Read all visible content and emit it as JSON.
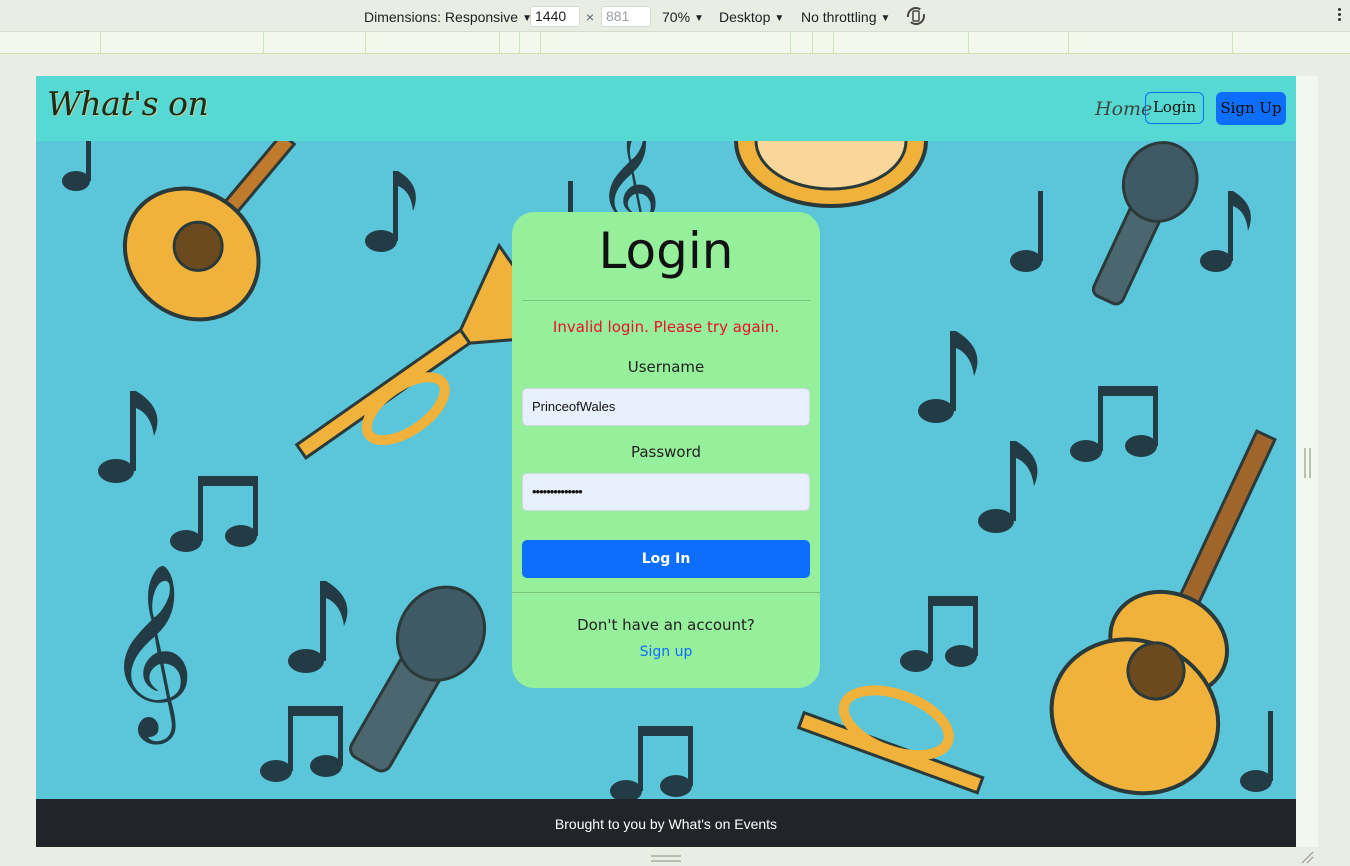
{
  "devtools": {
    "dimensions_label": "Dimensions: Responsive",
    "width_value": "1440",
    "height_placeholder": "881",
    "times": "×",
    "zoom": "70%",
    "device": "Desktop",
    "throttling": "No throttling"
  },
  "site": {
    "brand": "What's on",
    "nav": {
      "home": "Home",
      "login": "Login",
      "signup": "Sign Up"
    }
  },
  "login_card": {
    "title": "Login",
    "error": "Invalid login. Please try again.",
    "username_label": "Username",
    "username_value": "PrinceofWales",
    "password_label": "Password",
    "password_value": "••••••••••••••",
    "submit_label": "Log In",
    "no_account_text": "Don't have an account?",
    "signup_link": "Sign up"
  },
  "footer": {
    "text": "Brought to you by What's on Events"
  },
  "colors": {
    "navbar": "#55d9d2",
    "background": "#5bc6d9",
    "card": "#95ef9b",
    "primary": "#0d6efd",
    "error": "#e8102a",
    "footer": "#212529"
  }
}
